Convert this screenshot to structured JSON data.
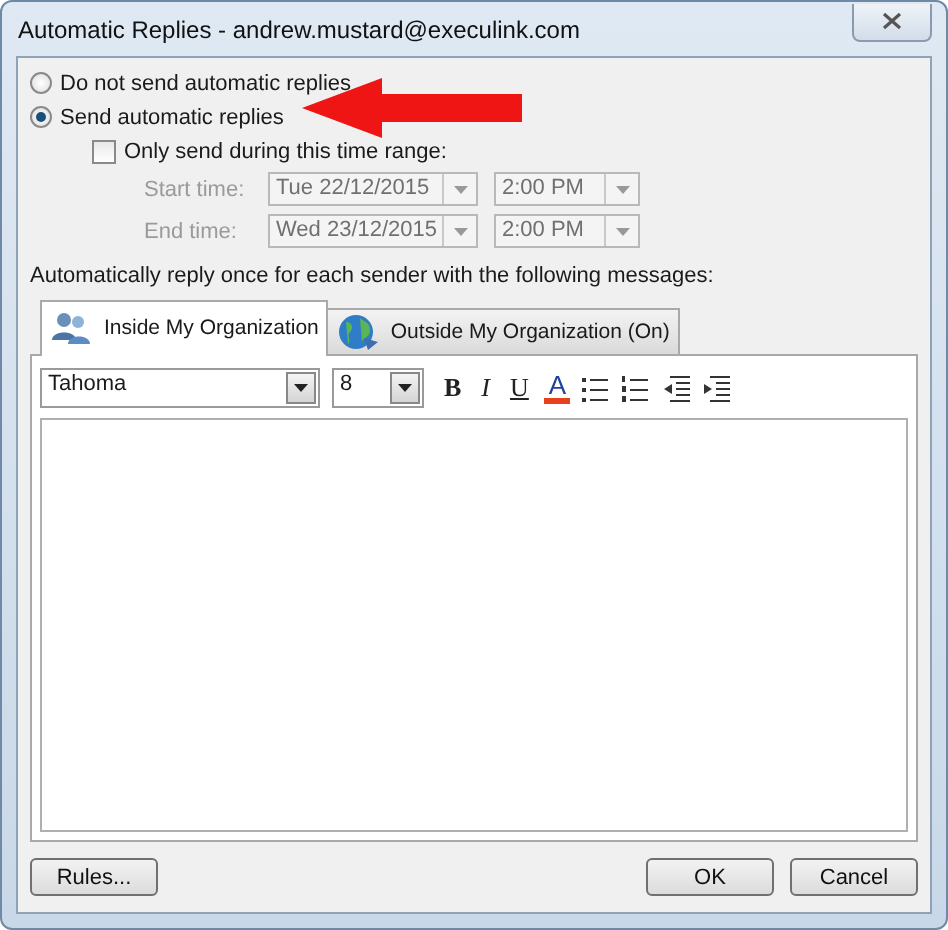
{
  "window": {
    "title": "Automatic Replies - andrew.mustard@execulink.com"
  },
  "reply_options": [
    {
      "label": "Do not send automatic replies",
      "selected": false
    },
    {
      "label": "Send automatic replies",
      "selected": true
    }
  ],
  "time_range": {
    "label": "Only send during this time range:",
    "checked": false,
    "fields": [
      {
        "label": "Start time:",
        "date": "Tue 22/12/2015",
        "time": "2:00 PM",
        "disabled": true
      },
      {
        "label": "End time:",
        "date": "Wed 23/12/2015",
        "time": "2:00 PM",
        "disabled": true
      }
    ]
  },
  "messages_label": "Automatically reply once for each sender with the following messages:",
  "tabs": [
    {
      "label": "Inside My Organization",
      "selected": true,
      "kind": "people"
    },
    {
      "label": "Outside My Organization (On)",
      "selected": false,
      "kind": "globe"
    }
  ],
  "toolbar": {
    "font": "Tahoma",
    "size": "8",
    "format_buttons": [
      "B",
      "I",
      "U",
      "A"
    ]
  },
  "buttons": {
    "left": [
      "Rules..."
    ],
    "right": [
      "OK",
      "Cancel"
    ]
  }
}
